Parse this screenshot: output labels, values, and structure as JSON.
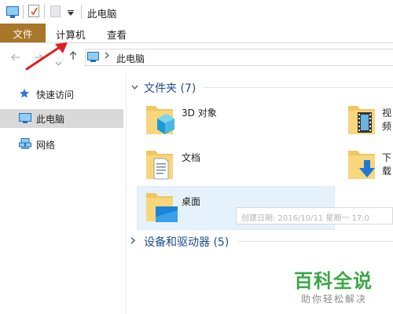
{
  "window": {
    "title": "此电脑"
  },
  "ribbon": {
    "tabs": [
      {
        "label": "文件",
        "active": true
      },
      {
        "label": "计算机"
      },
      {
        "label": "查看"
      }
    ]
  },
  "address_bar": {
    "path": "此电脑"
  },
  "sidebar": {
    "items": [
      {
        "label": "快速访问",
        "icon": "star-icon"
      },
      {
        "label": "此电脑",
        "icon": "computer-icon",
        "selected": true
      },
      {
        "label": "网络",
        "icon": "network-icon"
      }
    ]
  },
  "main": {
    "folders_group": {
      "title": "文件夹 (7)",
      "items": [
        {
          "label": "3D 对象",
          "icon": "3d-objects-folder-icon"
        },
        {
          "label": "视频",
          "icon": "videos-folder-icon"
        },
        {
          "label": "文档",
          "icon": "documents-folder-icon"
        },
        {
          "label": "下载",
          "icon": "downloads-folder-icon"
        },
        {
          "label": "桌面",
          "icon": "desktop-folder-icon",
          "selected": true
        }
      ]
    },
    "tooltip": "创建日期: 2016/10/11 星期一 17:0",
    "devices_group": {
      "title": "设备和驱动器 (5)"
    }
  },
  "watermark": {
    "title": "百科全说",
    "subtitle": "助你轻松解决"
  },
  "colors": {
    "file_tab": "#a8772a",
    "group_header": "#1e4e8c",
    "selection": "#e6f2fb",
    "annotation_arrow": "#e02020",
    "watermark_green": "#3aa845"
  }
}
